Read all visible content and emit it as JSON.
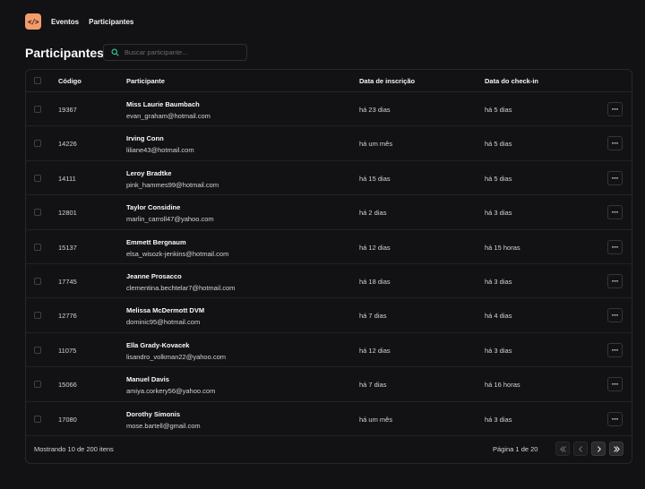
{
  "nav": {
    "logo_text": "</>",
    "links": [
      "Eventos",
      "Participantes"
    ]
  },
  "page": {
    "title": "Participantes",
    "search_placeholder": "Buscar participante...",
    "search_value": ""
  },
  "table": {
    "headers": {
      "code": "Código",
      "participant": "Participante",
      "registered": "Data de inscrição",
      "checkin": "Data do check-in"
    },
    "rows": [
      {
        "code": "19367",
        "name": "Miss Laurie Baumbach",
        "email": "evan_graham@hotmail.com",
        "registered": "há 23 dias",
        "checkin": "há 5 dias"
      },
      {
        "code": "14226",
        "name": "Irving Conn",
        "email": "liliane43@hotmail.com",
        "registered": "há um mês",
        "checkin": "há 5 dias"
      },
      {
        "code": "14111",
        "name": "Leroy Bradtke",
        "email": "pink_hammes99@hotmail.com",
        "registered": "há 15 dias",
        "checkin": "há 5 dias"
      },
      {
        "code": "12801",
        "name": "Taylor Considine",
        "email": "marlin_carroll47@yahoo.com",
        "registered": "há 2 dias",
        "checkin": "há 3 dias"
      },
      {
        "code": "15137",
        "name": "Emmett Bergnaum",
        "email": "elsa_wisozk-jenkins@hotmail.com",
        "registered": "há 12 dias",
        "checkin": "há 15 horas"
      },
      {
        "code": "17745",
        "name": "Jeanne Prosacco",
        "email": "clementina.bechtelar7@hotmail.com",
        "registered": "há 18 dias",
        "checkin": "há 3 dias"
      },
      {
        "code": "12776",
        "name": "Melissa McDermott DVM",
        "email": "dominic95@hotmail.com",
        "registered": "há 7 dias",
        "checkin": "há 4 dias"
      },
      {
        "code": "11075",
        "name": "Ella Grady-Kovacek",
        "email": "lisandro_volkman22@yahoo.com",
        "registered": "há 12 dias",
        "checkin": "há 3 dias"
      },
      {
        "code": "15066",
        "name": "Manuel Davis",
        "email": "amiya.corkery56@yahoo.com",
        "registered": "há 7 dias",
        "checkin": "há 16 horas"
      },
      {
        "code": "17080",
        "name": "Dorothy Simonis",
        "email": "mose.bartell@gmail.com",
        "registered": "há um mês",
        "checkin": "há 3 dias"
      }
    ],
    "row_menu_label": "···"
  },
  "footer": {
    "showing": "Mostrando 10 de 200 itens",
    "page_info": "Página 1 de 20"
  },
  "icons": {
    "search": "search-icon",
    "row_menu": "more-horizontal-icon",
    "first": "chevrons-left-icon",
    "prev": "chevron-left-icon",
    "next": "chevron-right-icon",
    "last": "chevrons-right-icon"
  },
  "colors": {
    "background": "#121214",
    "accent": "#f59b6b",
    "border": "#27272a"
  }
}
